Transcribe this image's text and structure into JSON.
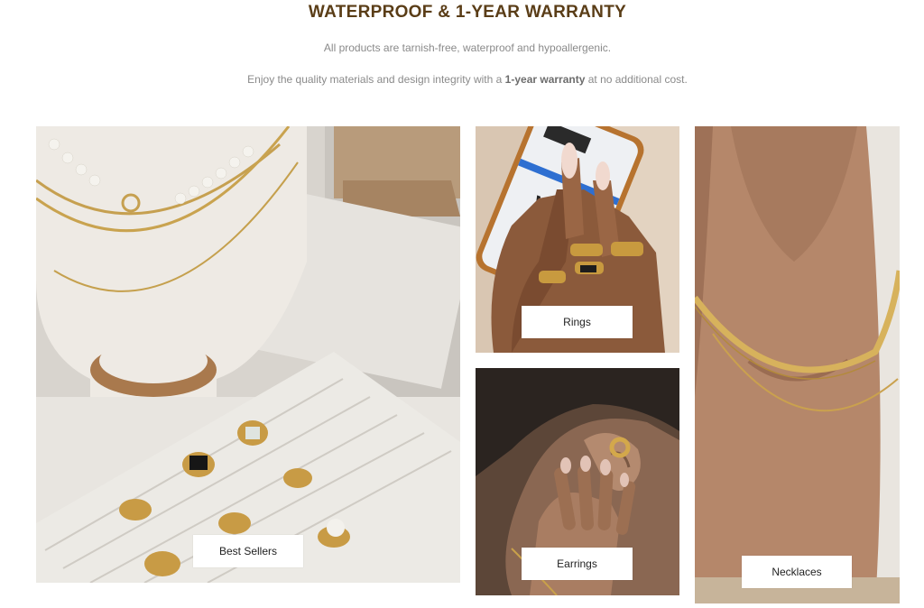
{
  "header": {
    "title": "WATERPROOF & 1-YEAR WARRANTY",
    "line1": "All products are tarnish-free, waterproof and hypoallergenic.",
    "line2_prefix": "Enjoy the quality materials and design integrity with a ",
    "line2_bold": "1-year warranty",
    "line2_suffix": " at no additional cost."
  },
  "categories": {
    "best_sellers": "Best Sellers",
    "rings": "Rings",
    "earrings": "Earrings",
    "necklaces": "Necklaces"
  }
}
